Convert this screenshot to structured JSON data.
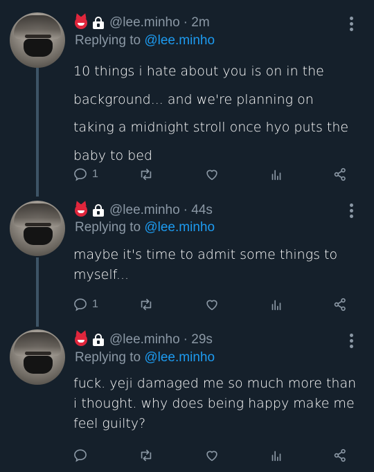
{
  "tweets": [
    {
      "handle": "@lee.minho",
      "time": "· 2m",
      "replying_label": "Replying to",
      "replying_to": "@lee.minho",
      "text": "10 things i hate about you is on in the background... and we're planning on taking a midnight stroll once hyo puts the baby to bed",
      "reply_count": "1"
    },
    {
      "handle": "@lee.minho",
      "time": "· 44s",
      "replying_label": "Replying to",
      "replying_to": "@lee.minho",
      "text": "maybe it's time to admit some things to myself...",
      "reply_count": "1"
    },
    {
      "handle": "@lee.minho",
      "time": "· 29s",
      "replying_label": "Replying to",
      "replying_to": "@lee.minho",
      "text": "fuck. yeji damaged me so much more than i thought. why does being happy make me feel guilty?",
      "reply_count": ""
    }
  ],
  "icons": {
    "name_emoji": "devil-emoji",
    "protected": "lock-icon",
    "reply": "reply-icon",
    "retweet": "retweet-icon",
    "like": "heart-icon",
    "analytics": "analytics-icon",
    "share": "share-icon",
    "more": "more-icon"
  },
  "colors": {
    "background": "#15202b",
    "secondary_text": "#8b98a5",
    "link": "#1d9bf0",
    "thread_line": "#3d5466"
  }
}
